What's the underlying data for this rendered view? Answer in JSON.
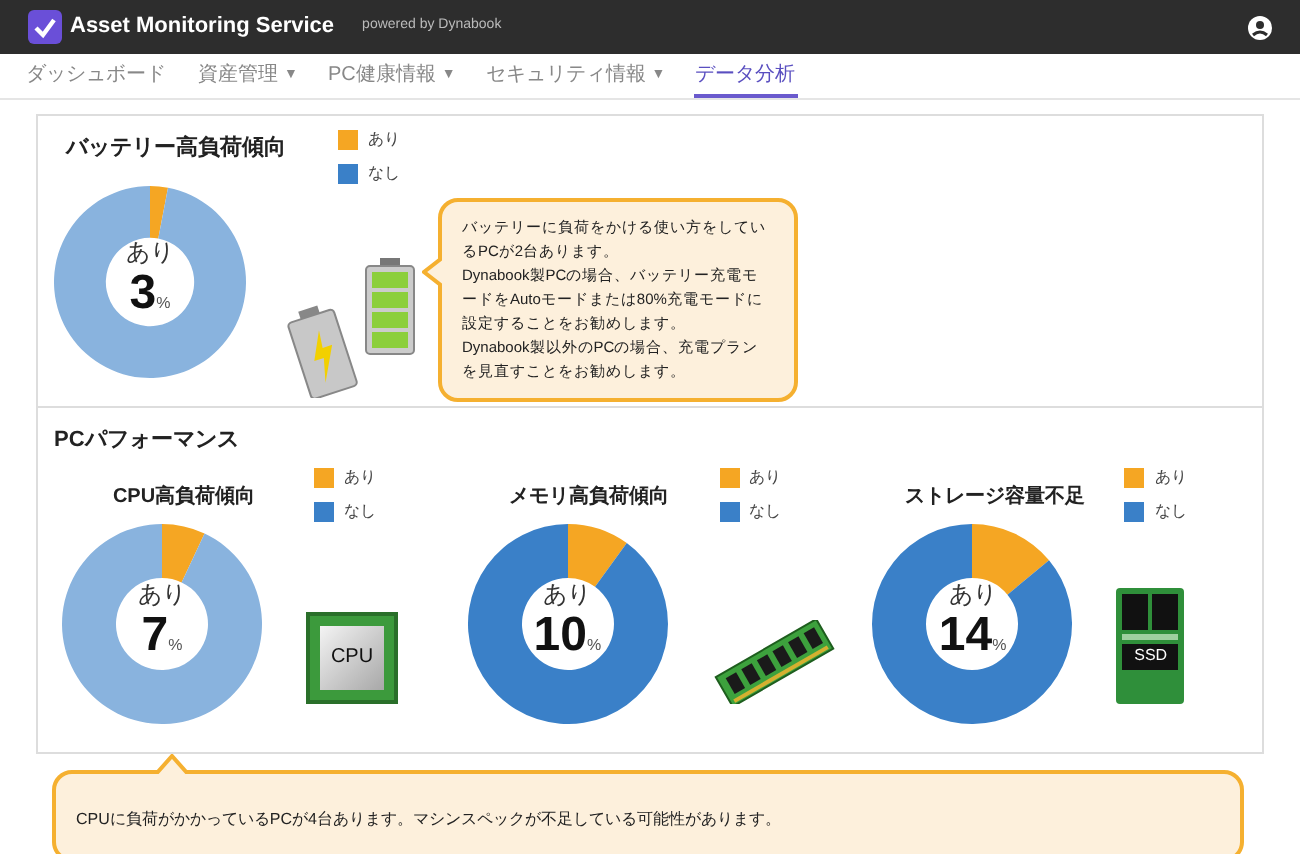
{
  "header": {
    "title": "Asset Monitoring Service",
    "subtitle": "powered by Dynabook"
  },
  "nav": [
    {
      "label": "ダッシュボード",
      "selected": false
    },
    {
      "label": "資産管理",
      "caret": "▼",
      "selected": false
    },
    {
      "label": "PC健康情報",
      "caret": "▼",
      "selected": false
    },
    {
      "label": "セキュリティ情報",
      "caret": "▼",
      "selected": false
    },
    {
      "label": "データ分析",
      "selected": true
    }
  ],
  "battery": {
    "title": "バッテリー高負荷傾向",
    "center_label": "あり",
    "center_value": "3",
    "unit": "%",
    "selected": true,
    "chart_data": {
      "type": "donut",
      "categories": [
        "あり",
        "なし"
      ],
      "values": [
        3,
        97
      ]
    },
    "callout": [
      "バッテリーに負荷をかける使い方をしているPCが2台あります。",
      "Dynabook製PCの場合、バッテリー充電モードをAutoモードまたは80%充電モードに設定することをお勧めします。",
      "Dynabook製以外のPCの場合、充電プランを見直すことをお勧めします。"
    ]
  },
  "performance": {
    "title": "PCパフォーマンス",
    "charts": [
      {
        "kind": "cpu",
        "title": "CPU高負荷傾向",
        "center_label": "あり",
        "center_value": "7",
        "unit": "%",
        "selected": true,
        "icon_label": "CPU",
        "chart_data": {
          "type": "donut",
          "categories": [
            "あり",
            "なし"
          ],
          "values": [
            7,
            93
          ]
        }
      },
      {
        "kind": "memory",
        "title": "メモリ高負荷傾向",
        "center_label": "あり",
        "center_value": "10",
        "unit": "%",
        "selected": false,
        "chart_data": {
          "type": "donut",
          "categories": [
            "あり",
            "なし"
          ],
          "values": [
            10,
            90
          ]
        }
      },
      {
        "kind": "storage",
        "title": "ストレージ容量不足",
        "center_label": "あり",
        "center_value": "14",
        "unit": "%",
        "selected": false,
        "icon_label": "SSD",
        "chart_data": {
          "type": "donut",
          "categories": [
            "あり",
            "なし"
          ],
          "values": [
            14,
            86
          ]
        }
      }
    ],
    "callout": "CPUに負荷がかかっているPCが4台あります。マシンスペックが不足している可能性があります。"
  }
}
